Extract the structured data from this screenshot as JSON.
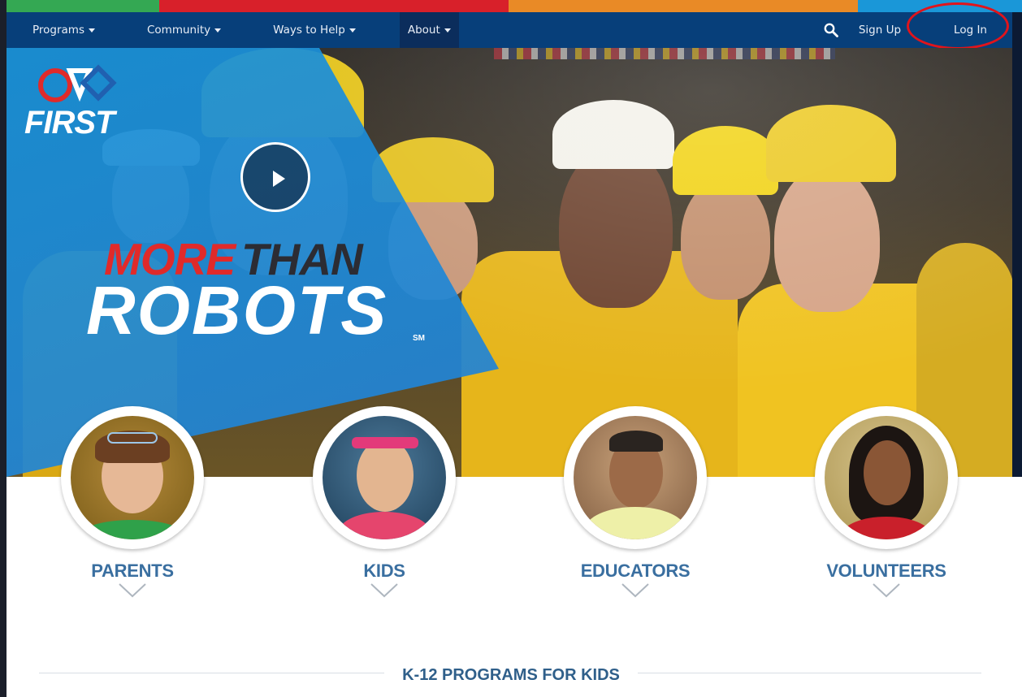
{
  "stripe_colors": [
    "#34a853",
    "#d8202a",
    "#e98a26",
    "#1a97d8"
  ],
  "nav": {
    "items": [
      {
        "label": "Programs"
      },
      {
        "label": "Community"
      },
      {
        "label": "Ways to Help"
      },
      {
        "label": "About"
      }
    ],
    "active_item": "About",
    "search_icon": "search-icon",
    "sign_up": "Sign Up",
    "log_in": "Log In",
    "highlight_color": "#e1141b"
  },
  "hero": {
    "logo_text": "FIRST",
    "tagline_more": "MORE",
    "tagline_than": "THAN",
    "tagline_robots": "ROBOTS",
    "service_mark": "SM",
    "play_icon": "play-icon"
  },
  "audiences": [
    {
      "label": "PARENTS"
    },
    {
      "label": "KIDS"
    },
    {
      "label": "EDUCATORS"
    },
    {
      "label": "VOLUNTEERS"
    }
  ],
  "section_heading": "K-12 PROGRAMS FOR KIDS",
  "colors": {
    "nav_bg": "#073f7a",
    "accent_blue": "#1893db",
    "label_blue": "#3a6fa0"
  }
}
